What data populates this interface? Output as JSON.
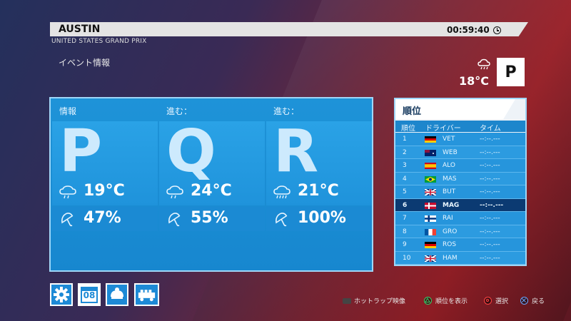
{
  "header": {
    "venue": "AUSTIN",
    "event": "UNITED STATES GRAND PRIX",
    "time": "00:59:40"
  },
  "section_title": "イベント情報",
  "current": {
    "temperature": "18°C",
    "session": "P",
    "weather_icon": "cloud-rain-icon"
  },
  "sessions": [
    {
      "label": "情報",
      "letter": "P",
      "temperature": "19°C",
      "rain_chance": "47%",
      "weather_icon": "cloud-rain-icon"
    },
    {
      "label": "進む：",
      "letter": "Q",
      "temperature": "24°C",
      "rain_chance": "55%",
      "weather_icon": "cloud-rain-icon"
    },
    {
      "label": "進む：",
      "letter": "R",
      "temperature": "21°C",
      "rain_chance": "100%",
      "weather_icon": "cloud-heavy-rain-icon"
    }
  ],
  "standings": {
    "title": "順位",
    "columns": {
      "position": "順位",
      "driver": "ドライバー",
      "time": "タイム"
    },
    "rows": [
      {
        "pos": "1",
        "driver": "VET",
        "time": "--:--.---",
        "flag": "germany"
      },
      {
        "pos": "2",
        "driver": "WEB",
        "time": "--:--.---",
        "flag": "australia"
      },
      {
        "pos": "3",
        "driver": "ALO",
        "time": "--:--.---",
        "flag": "spain"
      },
      {
        "pos": "4",
        "driver": "MAS",
        "time": "--:--.---",
        "flag": "brazil"
      },
      {
        "pos": "5",
        "driver": "BUT",
        "time": "--:--.---",
        "flag": "uk"
      },
      {
        "pos": "6",
        "driver": "MAG",
        "time": "--:--.---",
        "flag": "denmark"
      },
      {
        "pos": "7",
        "driver": "RAI",
        "time": "--:--.---",
        "flag": "finland"
      },
      {
        "pos": "8",
        "driver": "GRO",
        "time": "--:--.---",
        "flag": "france"
      },
      {
        "pos": "9",
        "driver": "ROS",
        "time": "--:--.---",
        "flag": "germany"
      },
      {
        "pos": "10",
        "driver": "HAM",
        "time": "--:--.---",
        "flag": "uk"
      }
    ],
    "highlight_index": 5
  },
  "toolbar": {
    "calendar_number": "08",
    "icons": [
      "gear-icon",
      "calendar-icon",
      "helmet-icon",
      "garage-icon"
    ]
  },
  "hints": {
    "hotlap": "ホットラップ映像",
    "standings": "順位を表示",
    "select": "選択",
    "back": "戻る"
  },
  "colors": {
    "panel_blue": "#1e93d8",
    "highlight": "#0b3a72",
    "triangle": "#2fd06a",
    "circle": "#ff4343",
    "cross": "#6aa6ff"
  }
}
